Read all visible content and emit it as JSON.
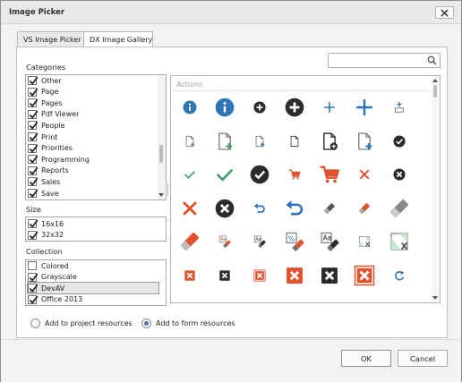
{
  "window": {
    "title": "Image Picker"
  },
  "tabs": [
    {
      "label": "VS Image Picker",
      "active": false
    },
    {
      "label": "DX Image Gallery",
      "active": true
    }
  ],
  "search": {
    "value": "",
    "placeholder": ""
  },
  "categories": {
    "label": "Categories",
    "items": [
      {
        "label": "Other",
        "checked": true
      },
      {
        "label": "Page",
        "checked": true
      },
      {
        "label": "Pages",
        "checked": true
      },
      {
        "label": "Pdf Viewer",
        "checked": true
      },
      {
        "label": "People",
        "checked": true
      },
      {
        "label": "Print",
        "checked": true
      },
      {
        "label": "Priorities",
        "checked": true
      },
      {
        "label": "Programming",
        "checked": true
      },
      {
        "label": "Reports",
        "checked": true
      },
      {
        "label": "Sales",
        "checked": true
      },
      {
        "label": "Save",
        "checked": true
      }
    ]
  },
  "size": {
    "label": "Size",
    "items": [
      {
        "label": "16x16",
        "checked": true
      },
      {
        "label": "32x32",
        "checked": true
      }
    ]
  },
  "collection": {
    "label": "Collection",
    "items": [
      {
        "label": "Colored",
        "checked": false
      },
      {
        "label": "Grayscale",
        "checked": true
      },
      {
        "label": "DevAV",
        "checked": true,
        "selected": true
      },
      {
        "label": "Office 2013",
        "checked": true
      }
    ]
  },
  "gallery": {
    "group": "Actions",
    "colors": {
      "blue": "#2e75b6",
      "green": "#48a06c",
      "red": "#e0512e",
      "dark": "#2b2b2b",
      "gray": "#707070"
    },
    "icons": [
      "about-small-icon",
      "about-large-icon",
      "add-small-icon",
      "add-large-icon",
      "plus-small-icon",
      "plus-large-icon",
      "add-item-icon",
      "add-file-small-icon",
      "add-file-large-icon",
      "add-file-blue-small-icon",
      "new-file-small-icon",
      "new-file-large-icon",
      "add-file-blue-large-icon",
      "check-circle-small-icon",
      "check-small-icon",
      "check-large-icon",
      "check-circle-large-icon",
      "cart-small-icon",
      "cart-large-icon",
      "close-small-icon",
      "cancel-circle-small-icon",
      "close-large-icon",
      "cancel-circle-large-icon",
      "undo-small-icon",
      "undo-large-icon",
      "eraser-small-icon",
      "eraser-red-small-icon",
      "eraser-gray-large-icon",
      "eraser-red-large-icon",
      "clear-format-small-icon",
      "clear-dark-small-icon",
      "clear-percent-icon",
      "clear-dark-large-icon",
      "clear-image-small-icon",
      "clear-image-large-icon",
      "delete-red-small-icon",
      "delete-dark-small-icon",
      "delete-red-box-small-icon",
      "delete-red-large-icon",
      "delete-dark-large-icon",
      "delete-red-box-large-icon",
      "refresh-icon"
    ]
  },
  "options": {
    "add_to_project": {
      "label": "Add to project resources",
      "selected": false
    },
    "add_to_form": {
      "label": "Add to form resources",
      "selected": true
    }
  },
  "buttons": {
    "ok": "OK",
    "cancel": "Cancel"
  }
}
